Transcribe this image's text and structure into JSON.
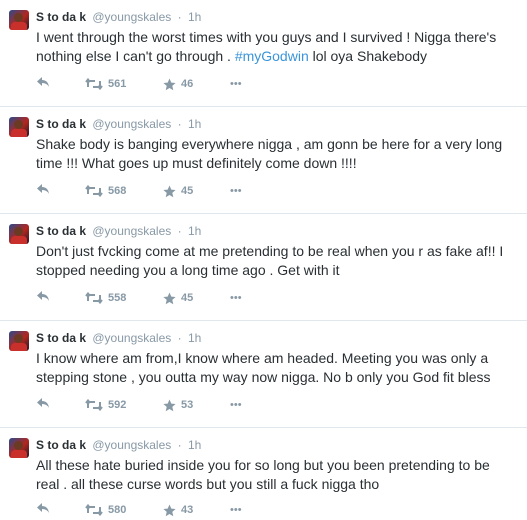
{
  "icons": {
    "reply": "reply-icon",
    "retweet": "retweet-icon",
    "favorite": "star-icon",
    "more": "more-icon"
  },
  "colors": {
    "text": "#292f33",
    "meta": "#8899a6",
    "hashtag": "#3b94d9",
    "divider": "#e1e8ed"
  },
  "tweets": [
    {
      "fullname": "S to da k",
      "username": "@youngskales",
      "dot": "·",
      "time": "1h",
      "text_before": "I went through the worst times with you guys and I survived ! Nigga there's nothing else I can't go through . ",
      "hashtag": "#myGodwin",
      "text_after": " lol oya Shakebody",
      "retweets": "561",
      "favorites": "46",
      "more": "•••"
    },
    {
      "fullname": "S to da k",
      "username": "@youngskales",
      "dot": "·",
      "time": "1h",
      "text_before": "Shake body is banging everywhere nigga , am gonn be here for a very long time !!! What goes up must definitely come down !!!!",
      "hashtag": "",
      "text_after": "",
      "retweets": "568",
      "favorites": "45",
      "more": "•••"
    },
    {
      "fullname": "S to da k",
      "username": "@youngskales",
      "dot": "·",
      "time": "1h",
      "text_before": "Don't just fvcking come at me pretending to be real when you r as fake af!! I stopped needing you a long time ago . Get with it",
      "hashtag": "",
      "text_after": "",
      "retweets": "558",
      "favorites": "45",
      "more": "•••"
    },
    {
      "fullname": "S to da k",
      "username": "@youngskales",
      "dot": "·",
      "time": "1h",
      "text_before": "I know where am from,I know where am headed. Meeting you was only a stepping stone , you outta my way now nigga. No b only you God fit bless",
      "hashtag": "",
      "text_after": "",
      "retweets": "592",
      "favorites": "53",
      "more": "•••"
    },
    {
      "fullname": "S to da k",
      "username": "@youngskales",
      "dot": "·",
      "time": "1h",
      "text_before": "All these hate buried inside you for so long but you been pretending to be real . all these curse words but you still a fuck nigga tho",
      "hashtag": "",
      "text_after": "",
      "retweets": "580",
      "favorites": "43",
      "more": "•••"
    }
  ]
}
